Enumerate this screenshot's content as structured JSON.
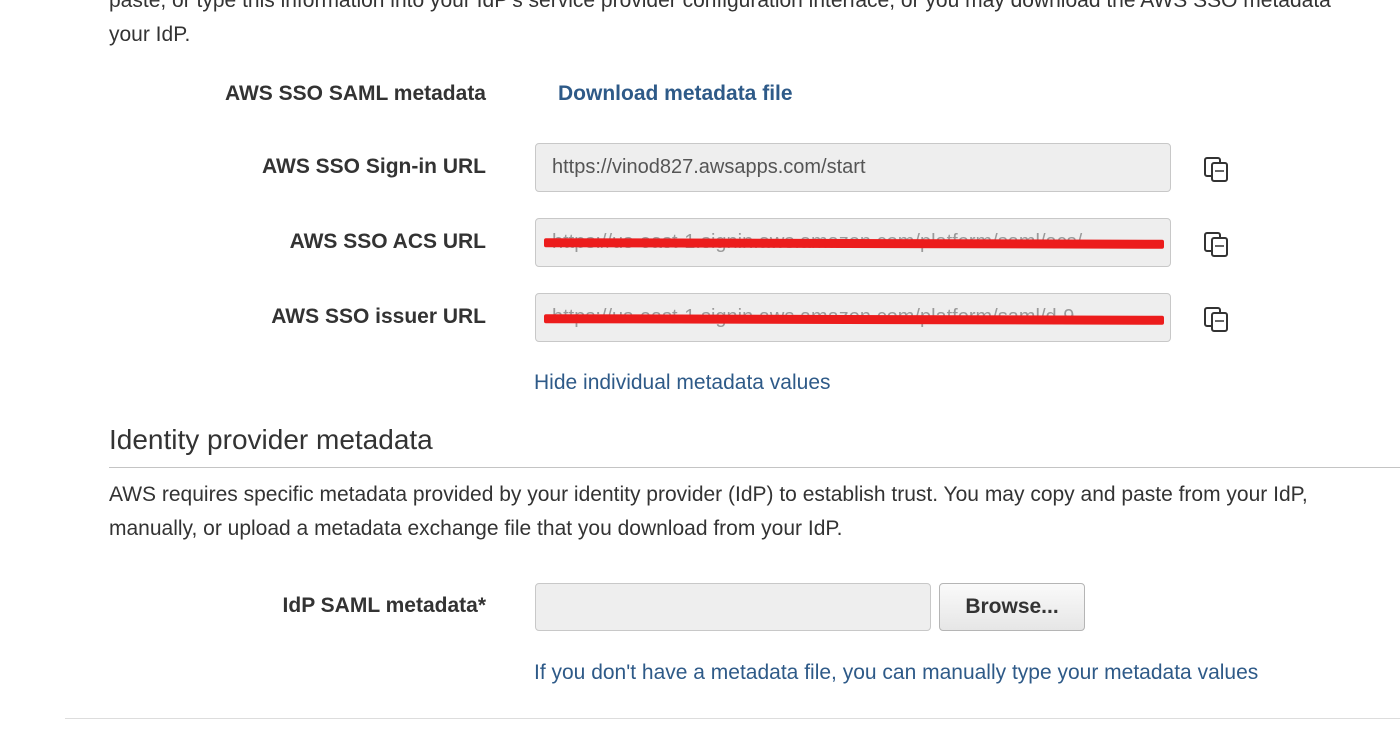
{
  "intro": {
    "line1": "paste, or type this information into your IdP's service provider configuration interface, or you may download the AWS SSO metadata",
    "line2": "your IdP."
  },
  "sso_metadata": {
    "label": "AWS SSO SAML metadata",
    "download_link": "Download metadata file"
  },
  "sign_in": {
    "label": "AWS SSO Sign-in URL",
    "value": "https://vinod827.awsapps.com/start"
  },
  "acs": {
    "label": "AWS SSO ACS URL",
    "value": "https://us-east-1.signin.aws.amazon.com/platform/saml/acs/"
  },
  "issuer": {
    "label": "AWS SSO issuer URL",
    "value": "https://us-east-1.signin.aws.amazon.com/platform/saml/d-9"
  },
  "hide_link": "Hide individual metadata values",
  "idp_section": {
    "title": "Identity provider metadata",
    "desc_line1": "AWS requires specific metadata provided by your identity provider (IdP) to establish trust. You may copy and paste from your IdP,",
    "desc_line2": "manually, or upload a metadata exchange file that you download from your IdP."
  },
  "idp_saml": {
    "label": "IdP SAML metadata*",
    "browse_label": "Browse...",
    "manual_link": "If you don't have a metadata file, you can manually type your metadata values"
  },
  "icons": {
    "copy": "copy-icon"
  },
  "colors": {
    "link": "#2e5a88",
    "redaction": "#ec1c1c",
    "field_bg": "#eeeeee"
  }
}
